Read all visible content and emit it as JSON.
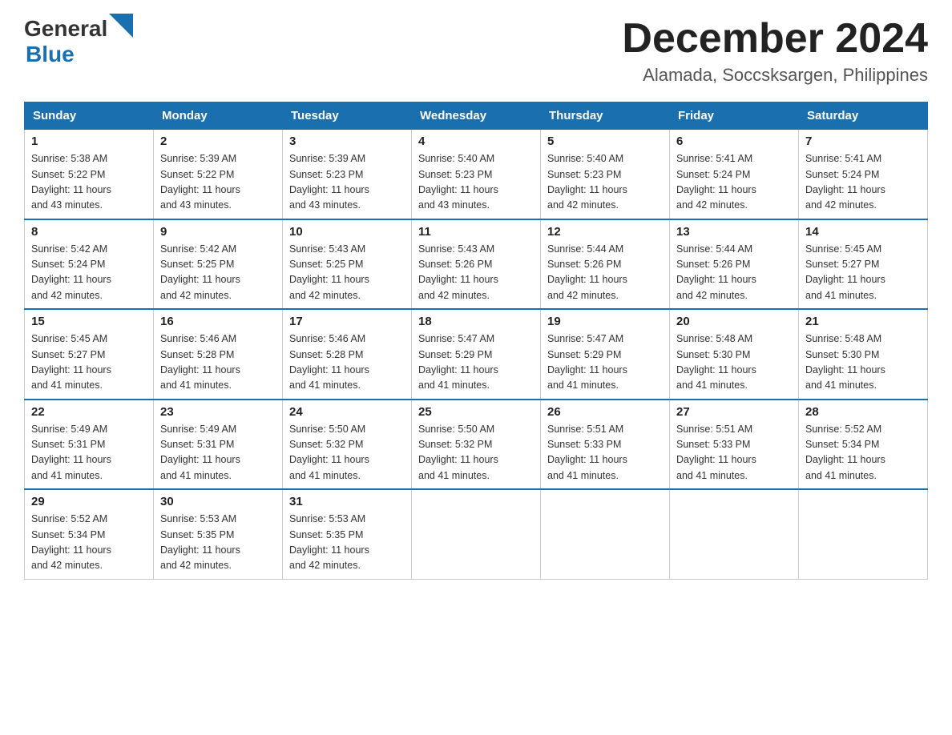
{
  "header": {
    "logo_general": "General",
    "logo_blue": "Blue",
    "title": "December 2024",
    "subtitle": "Alamada, Soccsksargen, Philippines"
  },
  "days_of_week": [
    "Sunday",
    "Monday",
    "Tuesday",
    "Wednesday",
    "Thursday",
    "Friday",
    "Saturday"
  ],
  "weeks": [
    [
      {
        "day": "1",
        "sunrise": "5:38 AM",
        "sunset": "5:22 PM",
        "daylight": "11 hours and 43 minutes."
      },
      {
        "day": "2",
        "sunrise": "5:39 AM",
        "sunset": "5:22 PM",
        "daylight": "11 hours and 43 minutes."
      },
      {
        "day": "3",
        "sunrise": "5:39 AM",
        "sunset": "5:23 PM",
        "daylight": "11 hours and 43 minutes."
      },
      {
        "day": "4",
        "sunrise": "5:40 AM",
        "sunset": "5:23 PM",
        "daylight": "11 hours and 43 minutes."
      },
      {
        "day": "5",
        "sunrise": "5:40 AM",
        "sunset": "5:23 PM",
        "daylight": "11 hours and 42 minutes."
      },
      {
        "day": "6",
        "sunrise": "5:41 AM",
        "sunset": "5:24 PM",
        "daylight": "11 hours and 42 minutes."
      },
      {
        "day": "7",
        "sunrise": "5:41 AM",
        "sunset": "5:24 PM",
        "daylight": "11 hours and 42 minutes."
      }
    ],
    [
      {
        "day": "8",
        "sunrise": "5:42 AM",
        "sunset": "5:24 PM",
        "daylight": "11 hours and 42 minutes."
      },
      {
        "day": "9",
        "sunrise": "5:42 AM",
        "sunset": "5:25 PM",
        "daylight": "11 hours and 42 minutes."
      },
      {
        "day": "10",
        "sunrise": "5:43 AM",
        "sunset": "5:25 PM",
        "daylight": "11 hours and 42 minutes."
      },
      {
        "day": "11",
        "sunrise": "5:43 AM",
        "sunset": "5:26 PM",
        "daylight": "11 hours and 42 minutes."
      },
      {
        "day": "12",
        "sunrise": "5:44 AM",
        "sunset": "5:26 PM",
        "daylight": "11 hours and 42 minutes."
      },
      {
        "day": "13",
        "sunrise": "5:44 AM",
        "sunset": "5:26 PM",
        "daylight": "11 hours and 42 minutes."
      },
      {
        "day": "14",
        "sunrise": "5:45 AM",
        "sunset": "5:27 PM",
        "daylight": "11 hours and 41 minutes."
      }
    ],
    [
      {
        "day": "15",
        "sunrise": "5:45 AM",
        "sunset": "5:27 PM",
        "daylight": "11 hours and 41 minutes."
      },
      {
        "day": "16",
        "sunrise": "5:46 AM",
        "sunset": "5:28 PM",
        "daylight": "11 hours and 41 minutes."
      },
      {
        "day": "17",
        "sunrise": "5:46 AM",
        "sunset": "5:28 PM",
        "daylight": "11 hours and 41 minutes."
      },
      {
        "day": "18",
        "sunrise": "5:47 AM",
        "sunset": "5:29 PM",
        "daylight": "11 hours and 41 minutes."
      },
      {
        "day": "19",
        "sunrise": "5:47 AM",
        "sunset": "5:29 PM",
        "daylight": "11 hours and 41 minutes."
      },
      {
        "day": "20",
        "sunrise": "5:48 AM",
        "sunset": "5:30 PM",
        "daylight": "11 hours and 41 minutes."
      },
      {
        "day": "21",
        "sunrise": "5:48 AM",
        "sunset": "5:30 PM",
        "daylight": "11 hours and 41 minutes."
      }
    ],
    [
      {
        "day": "22",
        "sunrise": "5:49 AM",
        "sunset": "5:31 PM",
        "daylight": "11 hours and 41 minutes."
      },
      {
        "day": "23",
        "sunrise": "5:49 AM",
        "sunset": "5:31 PM",
        "daylight": "11 hours and 41 minutes."
      },
      {
        "day": "24",
        "sunrise": "5:50 AM",
        "sunset": "5:32 PM",
        "daylight": "11 hours and 41 minutes."
      },
      {
        "day": "25",
        "sunrise": "5:50 AM",
        "sunset": "5:32 PM",
        "daylight": "11 hours and 41 minutes."
      },
      {
        "day": "26",
        "sunrise": "5:51 AM",
        "sunset": "5:33 PM",
        "daylight": "11 hours and 41 minutes."
      },
      {
        "day": "27",
        "sunrise": "5:51 AM",
        "sunset": "5:33 PM",
        "daylight": "11 hours and 41 minutes."
      },
      {
        "day": "28",
        "sunrise": "5:52 AM",
        "sunset": "5:34 PM",
        "daylight": "11 hours and 41 minutes."
      }
    ],
    [
      {
        "day": "29",
        "sunrise": "5:52 AM",
        "sunset": "5:34 PM",
        "daylight": "11 hours and 42 minutes."
      },
      {
        "day": "30",
        "sunrise": "5:53 AM",
        "sunset": "5:35 PM",
        "daylight": "11 hours and 42 minutes."
      },
      {
        "day": "31",
        "sunrise": "5:53 AM",
        "sunset": "5:35 PM",
        "daylight": "11 hours and 42 minutes."
      },
      null,
      null,
      null,
      null
    ]
  ],
  "labels": {
    "sunrise": "Sunrise:",
    "sunset": "Sunset:",
    "daylight": "Daylight:"
  }
}
